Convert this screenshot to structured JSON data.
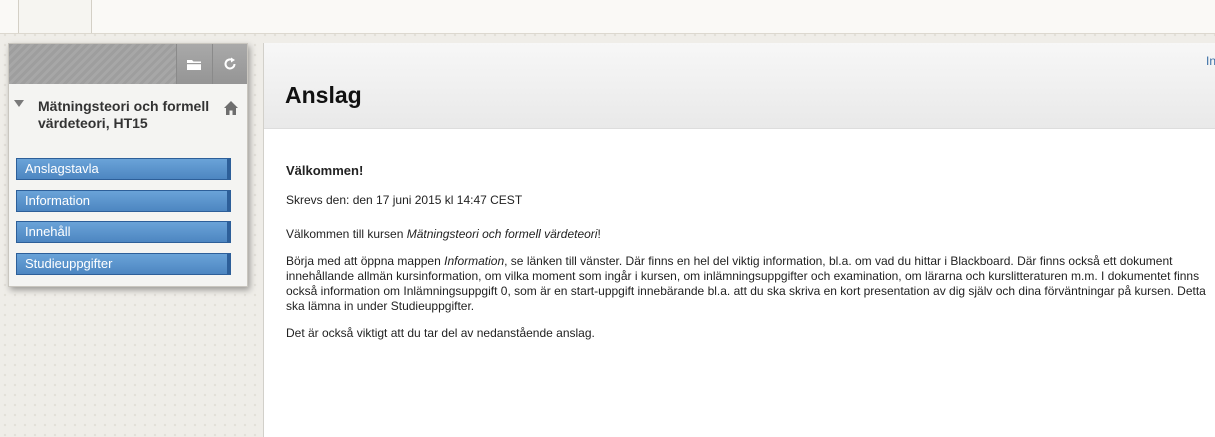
{
  "sidebar": {
    "tools": {
      "folder_icon": "folder-icon",
      "refresh_icon": "refresh-icon"
    },
    "course_title": "Mätningsteori och formell värdeteori, HT15",
    "items": [
      {
        "label": "Anslagstavla"
      },
      {
        "label": "Information"
      },
      {
        "label": "Innehåll"
      },
      {
        "label": "Studieuppgifter"
      }
    ]
  },
  "main": {
    "corner_text": "In",
    "title": "Anslag",
    "announcement": {
      "title": "Välkommen!",
      "posted": "Skrevs den: den 17 juni 2015 kl 14:47 CEST",
      "p1_pre": "Välkommen till kursen ",
      "p1_em": "Mätningsteori och formell värdeteori",
      "p1_post": "!",
      "p2_pre": "Börja med att öppna mappen ",
      "p2_em": "Information",
      "p2_post": ", se länken till vänster. Där finns en hel del viktig information, bl.a. om vad du hittar i Blackboard. Där finns också ett dokument innehållande allmän kursinformation, om vilka moment som ingår i kursen, om inlämningsuppgifter och examination, om lärarna och kurslitteraturen m.m. I dokumentet finns också information om Inlämningsuppgift 0, som är en start-uppgift innebärande bl.a. att du ska skriva en kort presentation av dig själv och dina förväntningar på kursen. Detta ska lämna in under Studieuppgifter.",
      "p3": "Det är också viktigt att du tar del av nedanstående anslag."
    }
  },
  "colors": {
    "nav_blue": "#4d86c1",
    "nav_border": "#2d5f99"
  }
}
